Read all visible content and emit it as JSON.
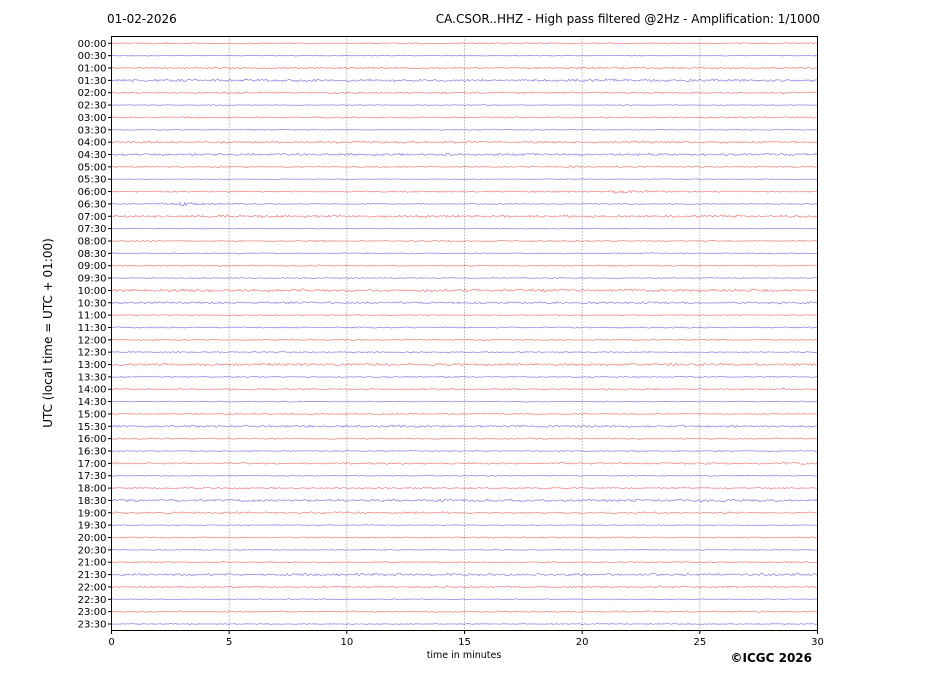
{
  "header": {
    "date": "01-02-2026",
    "title": "CA.CSOR..HHZ - High pass filtered @2Hz - Amplification: 1/1000"
  },
  "footer": {
    "copyright": "©ICGC 2026"
  },
  "axes": {
    "ylabel": "UTC (local time = UTC + 01:00)",
    "xlabel": "time in minutes",
    "x_ticks": [
      0,
      5,
      10,
      15,
      20,
      25,
      30
    ],
    "x_range_minutes": [
      0,
      30
    ],
    "grid_minutes": [
      5,
      10,
      15,
      20,
      25
    ],
    "grid_on": true
  },
  "colors": {
    "trace_red": "#dd2222",
    "trace_blue": "#2929cc",
    "grid": "#777777",
    "axis": "#000000",
    "text": "#000000"
  },
  "chart_data": {
    "type": "line",
    "subtype": "helicorder-seismogram",
    "title": "CA.CSOR..HHZ - High pass filtered @2Hz - Amplification: 1/1000",
    "date": "01-02-2026",
    "xlabel": "time in minutes",
    "ylabel": "UTC (local time = UTC + 01:00)",
    "x_range_minutes": [
      0,
      30
    ],
    "row_duration_minutes": 30,
    "legend": "none",
    "row_color_rule": "rows starting on the hour are red, half-hour rows are blue",
    "rows": [
      {
        "time": "00:00",
        "color": "red",
        "noise": 0.9,
        "events": []
      },
      {
        "time": "00:30",
        "color": "blue",
        "noise": 0.55,
        "events": []
      },
      {
        "time": "01:00",
        "color": "red",
        "noise": 1.3,
        "events": []
      },
      {
        "time": "01:30",
        "color": "blue",
        "noise": 1.8,
        "events": []
      },
      {
        "time": "02:00",
        "color": "red",
        "noise": 1.15,
        "events": []
      },
      {
        "time": "02:30",
        "color": "blue",
        "noise": 0.6,
        "events": []
      },
      {
        "time": "03:00",
        "color": "red",
        "noise": 1.05,
        "events": []
      },
      {
        "time": "03:30",
        "color": "blue",
        "noise": 0.6,
        "events": []
      },
      {
        "time": "04:00",
        "color": "red",
        "noise": 1.5,
        "events": []
      },
      {
        "time": "04:30",
        "color": "blue",
        "noise": 1.7,
        "events": []
      },
      {
        "time": "05:00",
        "color": "red",
        "noise": 0.95,
        "events": [
          {
            "start": 19.45,
            "peak": 19.65,
            "end": 20.05,
            "amp": 1.7
          }
        ]
      },
      {
        "time": "05:30",
        "color": "blue",
        "noise": 0.6,
        "events": []
      },
      {
        "time": "06:00",
        "color": "red",
        "noise": 0.95,
        "events": [
          {
            "start": 12.2,
            "peak": 12.35,
            "end": 12.65,
            "amp": 1.4
          },
          {
            "start": 20.4,
            "peak": 21.3,
            "end": 23.2,
            "amp": 1.1
          },
          {
            "start": 21.0,
            "peak": 21.35,
            "end": 21.95,
            "amp": 1.9
          }
        ]
      },
      {
        "time": "06:30",
        "color": "blue",
        "noise": 0.75,
        "events": [
          {
            "start": 0.9,
            "peak": 3.0,
            "end": 5.8,
            "amp": 1.1
          },
          {
            "start": 2.85,
            "peak": 3.05,
            "end": 3.4,
            "amp": 3.0
          }
        ]
      },
      {
        "time": "07:00",
        "color": "red",
        "noise": 1.6,
        "events": []
      },
      {
        "time": "07:30",
        "color": "blue",
        "noise": 0.55,
        "events": [
          {
            "start": 3.7,
            "peak": 3.85,
            "end": 4.15,
            "amp": 1.5
          }
        ]
      },
      {
        "time": "08:00",
        "color": "red",
        "noise": 0.95,
        "events": []
      },
      {
        "time": "08:30",
        "color": "blue",
        "noise": 0.8,
        "events": []
      },
      {
        "time": "09:00",
        "color": "red",
        "noise": 0.9,
        "events": []
      },
      {
        "time": "09:30",
        "color": "blue",
        "noise": 0.8,
        "events": []
      },
      {
        "time": "10:00",
        "color": "red",
        "noise": 1.85,
        "events": []
      },
      {
        "time": "10:30",
        "color": "blue",
        "noise": 1.45,
        "events": [
          {
            "start": 24.8,
            "peak": 25.0,
            "end": 25.35,
            "amp": 1.1
          }
        ]
      },
      {
        "time": "11:00",
        "color": "red",
        "noise": 0.7,
        "events": []
      },
      {
        "time": "11:30",
        "color": "blue",
        "noise": 0.95,
        "events": []
      },
      {
        "time": "12:00",
        "color": "red",
        "noise": 1.0,
        "events": []
      },
      {
        "time": "12:30",
        "color": "blue",
        "noise": 0.85,
        "events": []
      },
      {
        "time": "13:00",
        "color": "red",
        "noise": 1.75,
        "events": []
      },
      {
        "time": "13:30",
        "color": "blue",
        "noise": 0.95,
        "events": []
      },
      {
        "time": "14:00",
        "color": "red",
        "noise": 1.15,
        "events": []
      },
      {
        "time": "14:30",
        "color": "blue",
        "noise": 0.7,
        "events": []
      },
      {
        "time": "15:00",
        "color": "red",
        "noise": 0.85,
        "events": []
      },
      {
        "time": "15:30",
        "color": "blue",
        "noise": 1.55,
        "events": []
      },
      {
        "time": "16:00",
        "color": "red",
        "noise": 1.05,
        "events": []
      },
      {
        "time": "16:30",
        "color": "blue",
        "noise": 0.85,
        "events": []
      },
      {
        "time": "17:00",
        "color": "red",
        "noise": 1.3,
        "events": []
      },
      {
        "time": "17:30",
        "color": "blue",
        "noise": 0.75,
        "events": []
      },
      {
        "time": "18:00",
        "color": "red",
        "noise": 0.95,
        "events": []
      },
      {
        "time": "18:30",
        "color": "blue",
        "noise": 1.7,
        "events": []
      },
      {
        "time": "19:00",
        "color": "red",
        "noise": 1.35,
        "events": []
      },
      {
        "time": "19:30",
        "color": "blue",
        "noise": 0.75,
        "events": []
      },
      {
        "time": "20:00",
        "color": "red",
        "noise": 0.9,
        "events": []
      },
      {
        "time": "20:30",
        "color": "blue",
        "noise": 0.65,
        "events": []
      },
      {
        "time": "21:00",
        "color": "red",
        "noise": 0.85,
        "events": []
      },
      {
        "time": "21:30",
        "color": "blue",
        "noise": 1.8,
        "events": []
      },
      {
        "time": "22:00",
        "color": "red",
        "noise": 1.35,
        "events": []
      },
      {
        "time": "22:30",
        "color": "blue",
        "noise": 0.75,
        "events": []
      },
      {
        "time": "23:00",
        "color": "red",
        "noise": 1.05,
        "events": []
      },
      {
        "time": "23:30",
        "color": "blue",
        "noise": 0.65,
        "events": []
      }
    ]
  }
}
